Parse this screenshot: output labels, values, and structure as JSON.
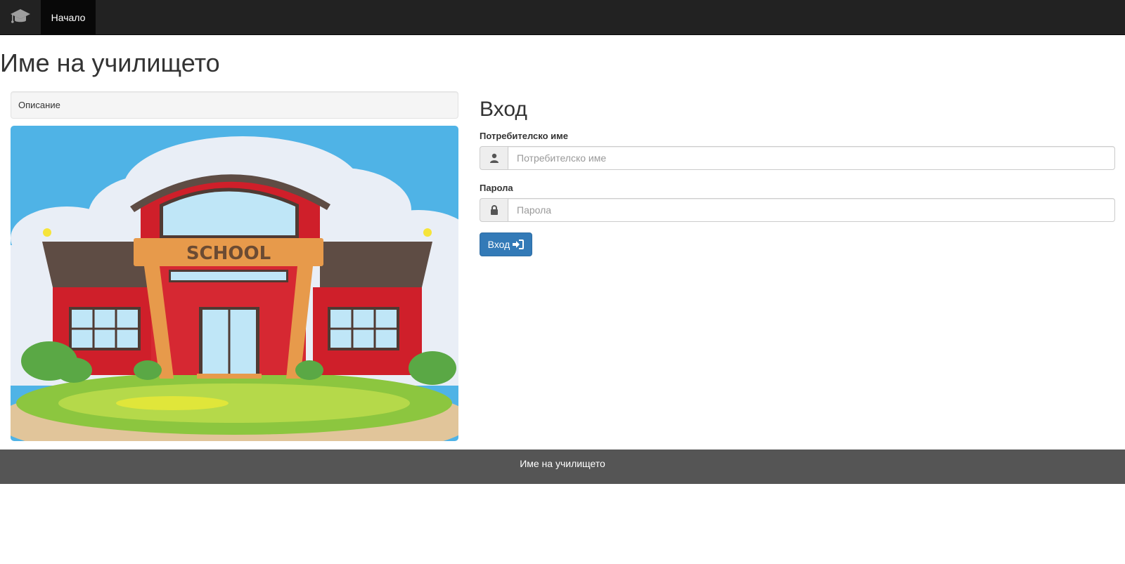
{
  "navbar": {
    "brand_icon": "graduation-cap-icon",
    "home_label": "Начало"
  },
  "page": {
    "title": "Име на училището"
  },
  "description": {
    "text": "Описание"
  },
  "image": {
    "sign_text": "SCHOOL"
  },
  "login": {
    "title": "Вход",
    "username_label": "Потребителско име",
    "username_placeholder": "Потребителско име",
    "username_icon": "user-icon",
    "password_label": "Парола",
    "password_placeholder": "Парола",
    "password_icon": "lock-icon",
    "button_label": "Вход",
    "button_icon": "sign-in-icon"
  },
  "footer": {
    "text": "Име на училището"
  },
  "colors": {
    "navbar": "#222222",
    "primary": "#337ab7",
    "footer": "#555555"
  }
}
